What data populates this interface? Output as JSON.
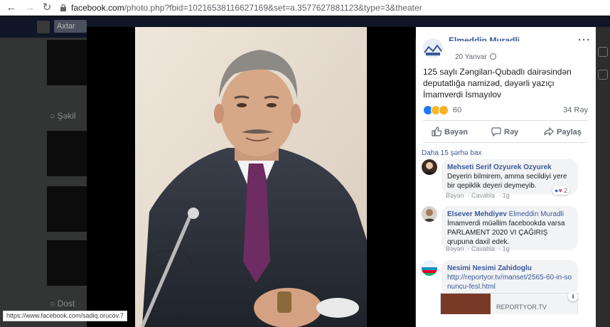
{
  "browser": {
    "url_host": "facebook.com",
    "url_rest": "/photo.php?fbid=10216538116627169&set=a.3577627881123&type=3&theater"
  },
  "background": {
    "search_text": "Axtar",
    "section_label": "Şəkil",
    "section_label_2": "Dost"
  },
  "post": {
    "page_name": "Elmeddin Muradli",
    "date": "20 Yanvar",
    "text": "125 saylı Zəngilan-Qubadlı dairəsindən deputatlığa namizəd, dəyərli yazıçı İmamverdi İsmayılov",
    "reaction_count": "60",
    "comment_count": "34 Rəy",
    "actions": {
      "like": "Bəyən",
      "comment": "Rəy",
      "share": "Paylaş"
    }
  },
  "comments_section": {
    "more_link": "Daha 15 şərhə bax",
    "comments": [
      {
        "author": "Mehseti Serif Ozyurek Ozyurek",
        "text": "Deyerin bilmirem, amma secildiyi yere bir qepiklik deyeri deymeyib.",
        "like": "Bəyən",
        "reply": "Cavabla",
        "time": "1g",
        "reactions": "2"
      },
      {
        "author": "Elsever Mehdiyev",
        "mention": "Elmeddin Muradli",
        "text": "İmamverdi müəllim facebookda varsa PARLAMENT 2020 VI ÇAĞIRIŞ qrupuna daxil edek.",
        "like": "Bəyən",
        "reply": "Cavabla",
        "time": "1g"
      },
      {
        "author": "Nesimi Nesimi Zahidoglu",
        "link": "http://reportyor.tv/manset/2565-60-in-sonuncu-fesl.html",
        "card_source": "REPORTYOR.TV"
      }
    ]
  },
  "status_bar": "https://www.facebook.com/sadiq.orucov.7",
  "colors": {
    "fb_blue": "#4267b2",
    "link": "#385898",
    "accent_like": "#2078f4"
  }
}
